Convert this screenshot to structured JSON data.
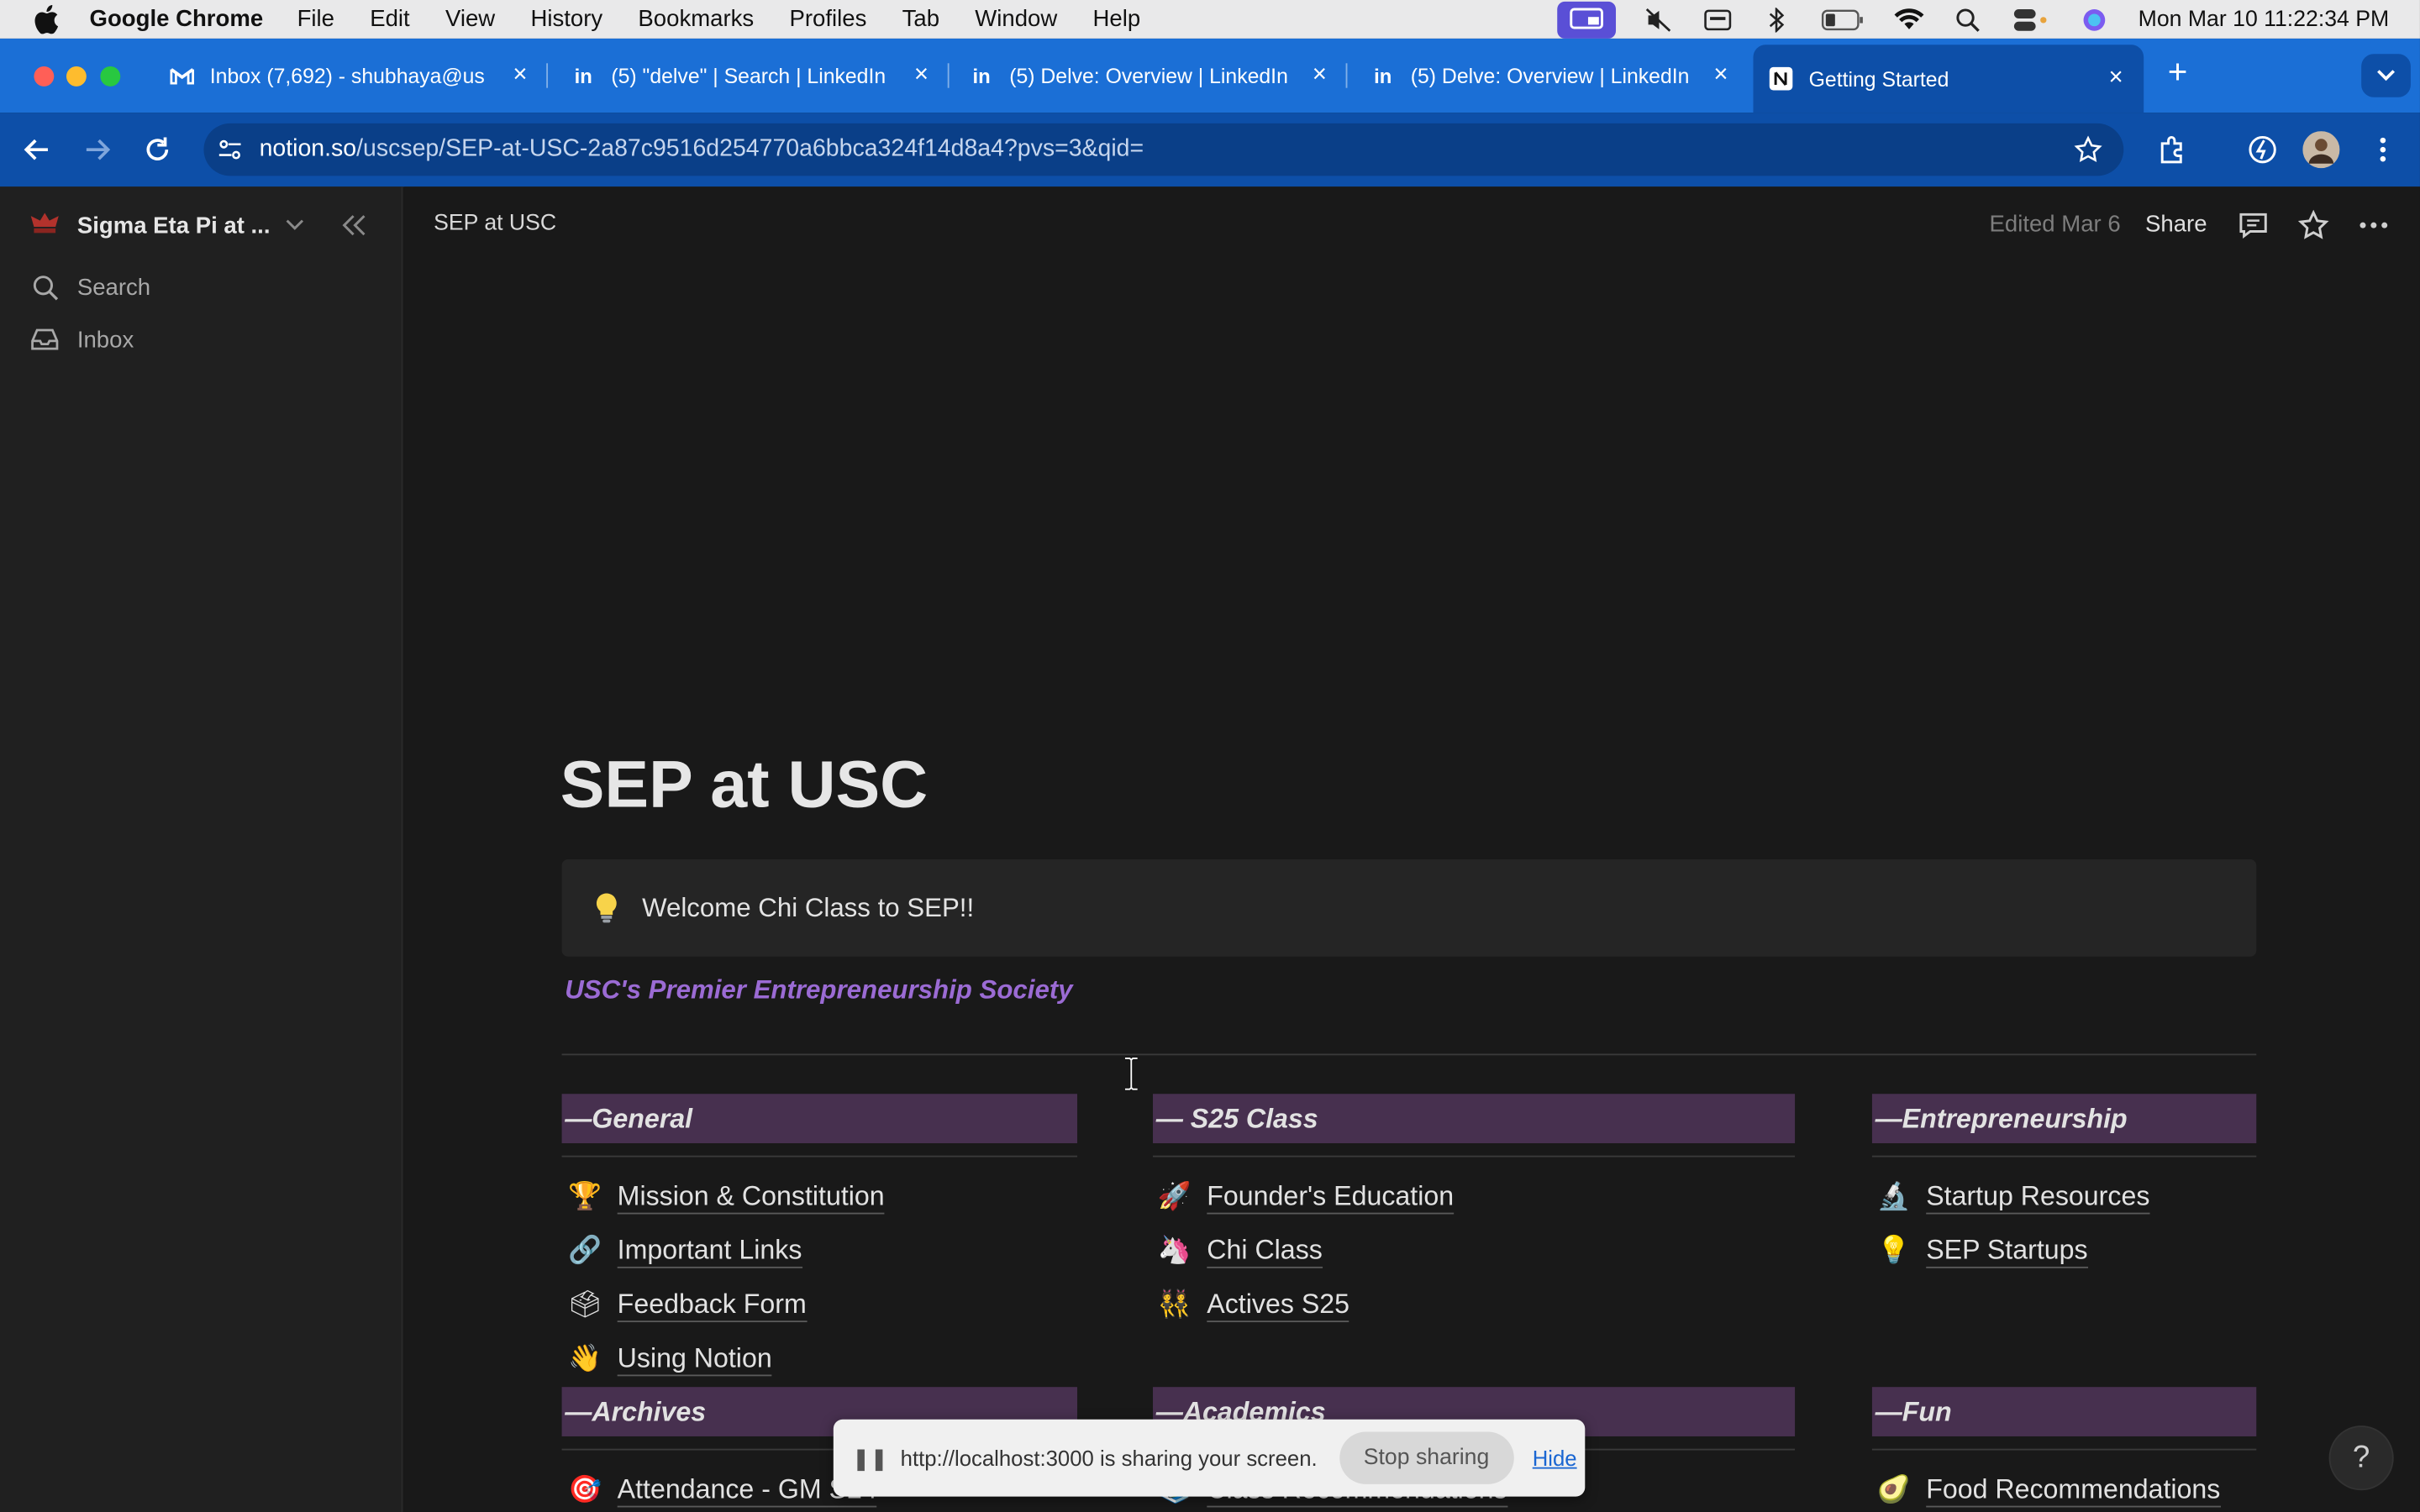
{
  "menubar": {
    "app": "Google Chrome",
    "items": [
      "File",
      "Edit",
      "View",
      "History",
      "Bookmarks",
      "Profiles",
      "Tab",
      "Window",
      "Help"
    ],
    "clock": "Mon Mar 10  11:22:34 PM"
  },
  "tabs": [
    {
      "title": "Inbox (7,692) - shubhaya@us",
      "icon": "gmail-icon"
    },
    {
      "title": "(5) \"delve\" | Search | LinkedIn",
      "icon": "linkedin-icon"
    },
    {
      "title": "(5) Delve: Overview | LinkedIn",
      "icon": "linkedin-icon"
    },
    {
      "title": "(5) Delve: Overview | LinkedIn",
      "icon": "linkedin-icon"
    },
    {
      "title": "Getting Started",
      "icon": "notion-icon",
      "active": true
    }
  ],
  "omnibox": {
    "domain": "notion.so",
    "path": "/uscsep/SEP-at-USC-2a87c9516d254770a6bbca324f14d8a4?pvs=3&qid="
  },
  "sidebar": {
    "workspace": "Sigma Eta Pi at ...",
    "items": [
      {
        "label": "Search",
        "icon": "search-icon"
      },
      {
        "label": "Inbox",
        "icon": "inbox-icon"
      }
    ]
  },
  "topbar": {
    "breadcrumb": "SEP at USC",
    "edited": "Edited Mar 6",
    "share": "Share"
  },
  "page": {
    "title": "SEP at USC",
    "callout": "Welcome Chi Class to SEP!!",
    "subtitle": "USC's Premier Entrepreneurship Society",
    "columns": [
      {
        "heading": "—General",
        "links": [
          {
            "emoji": "🏆",
            "label": "Mission & Constitution"
          },
          {
            "emoji": "🔗",
            "label": "Important Links"
          },
          {
            "emoji": "🗳",
            "label": "Feedback Form"
          },
          {
            "emoji": "👋",
            "label": "Using Notion"
          }
        ]
      },
      {
        "heading": "— S25 Class",
        "links": [
          {
            "emoji": "🚀",
            "label": "Founder's Education"
          },
          {
            "emoji": "🦄",
            "label": "Chi Class"
          },
          {
            "emoji": "👯",
            "label": "Actives S25"
          }
        ]
      },
      {
        "heading": "—Entrepreneurship",
        "links": [
          {
            "emoji": "🔬",
            "label": "Startup Resources"
          },
          {
            "emoji": "💡",
            "label": "SEP Startups"
          }
        ]
      }
    ],
    "row2": [
      {
        "heading": "—Archives",
        "link": {
          "emoji": "🎯",
          "label": "Attendance - GM S24"
        }
      },
      {
        "heading": "—Academics",
        "link": {
          "emoji": "📚",
          "label": "Class Recommendations"
        }
      },
      {
        "heading": "—Fun",
        "link": {
          "emoji": "🥑",
          "label": "Food Recommendations"
        }
      }
    ]
  },
  "sharebar": {
    "message": "http://localhost:3000 is sharing your screen.",
    "stop": "Stop sharing",
    "hide": "Hide"
  },
  "help": "?"
}
